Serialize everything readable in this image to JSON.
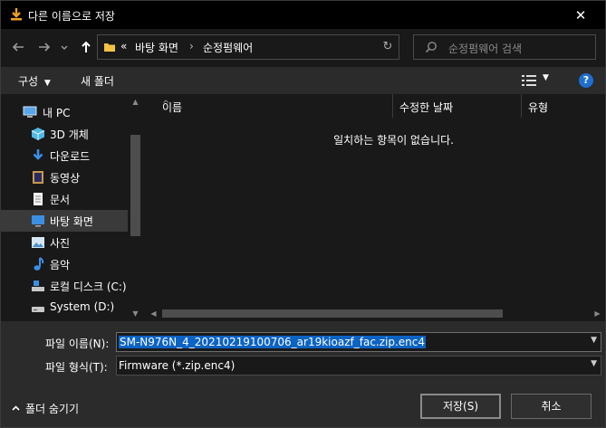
{
  "window": {
    "title": "다른 이름으로 저장",
    "close": "✕"
  },
  "address": {
    "overflow": "«",
    "crumbs": [
      "바탕 화면",
      "순정펌웨어"
    ],
    "separator": "›",
    "refresh": "↻"
  },
  "search": {
    "placeholder": "순정펌웨어 검색"
  },
  "toolbar": {
    "organize_label": "구성",
    "organize_caret": "▼",
    "new_folder_label": "새 폴더",
    "help": "?"
  },
  "nav": {
    "items": [
      {
        "label": "내 PC",
        "icon": "pc-icon"
      },
      {
        "label": "3D 개체",
        "icon": "cube-icon"
      },
      {
        "label": "다운로드",
        "icon": "download-icon"
      },
      {
        "label": "동영상",
        "icon": "video-icon"
      },
      {
        "label": "문서",
        "icon": "document-icon"
      },
      {
        "label": "바탕 화면",
        "icon": "desktop-icon",
        "selected": true
      },
      {
        "label": "사진",
        "icon": "pictures-icon"
      },
      {
        "label": "음악",
        "icon": "music-icon"
      },
      {
        "label": "로컬 디스크 (C:)",
        "icon": "local-disk-icon"
      },
      {
        "label": "System (D:)",
        "icon": "drive-icon"
      }
    ]
  },
  "columns": {
    "name": "이름",
    "modified": "수정한 날짜",
    "type": "유형"
  },
  "empty_message": "일치하는 항목이 없습니다.",
  "filename": {
    "label": "파일 이름(N):",
    "value": "SM-N976N_4_20210219100706_ar19kioazf_fac.zip.enc4"
  },
  "filetype": {
    "label": "파일 형식(T):",
    "value": "Firmware (*.zip.enc4)"
  },
  "footer": {
    "hide_folders": "폴더 숨기기",
    "save": "저장(S)",
    "cancel": "취소"
  },
  "colors": {
    "accent": "#0b63c4",
    "folder": "#f3c242",
    "download": "#f0a020"
  }
}
